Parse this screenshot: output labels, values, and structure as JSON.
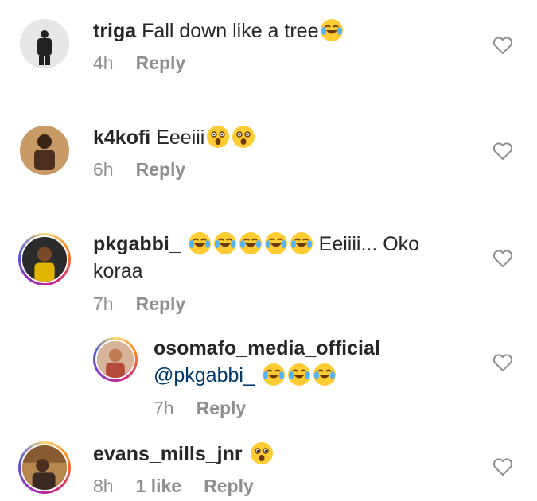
{
  "comments": [
    {
      "username": "triga",
      "text": "Fall down like a tree",
      "emojis": [
        "face-with-tears-of-joy-icon"
      ],
      "time": "4h",
      "reply_label": "Reply"
    },
    {
      "username": "k4kofi",
      "text": "Eeeiii",
      "emojis": [
        "astonished-face-icon",
        "astonished-face-icon"
      ],
      "time": "6h",
      "reply_label": "Reply"
    },
    {
      "username": "pkgabbi_",
      "text_after_emojis": "Eeiiii... Oko",
      "text_line2": "koraa",
      "emojis": [
        "face-with-tears-of-joy-icon",
        "face-with-tears-of-joy-icon",
        "face-with-tears-of-joy-icon",
        "face-with-tears-of-joy-icon",
        "face-with-tears-of-joy-icon"
      ],
      "time": "7h",
      "reply_label": "Reply"
    },
    {
      "username": "osomafo_media_official",
      "mention": "@pkgabbi_",
      "emojis": [
        "face-with-tears-of-joy-icon",
        "face-with-tears-of-joy-icon",
        "face-with-tears-of-joy-icon"
      ],
      "time": "7h",
      "reply_label": "Reply"
    },
    {
      "username": "evans_mills_jnr",
      "emojis": [
        "astonished-face-icon"
      ],
      "time": "8h",
      "likes": "1 like",
      "reply_label": "Reply"
    }
  ],
  "colors": {
    "text": "#262626",
    "meta": "#8e8e8e",
    "mention": "#00376b",
    "heart_stroke": "#8e8e8e"
  }
}
